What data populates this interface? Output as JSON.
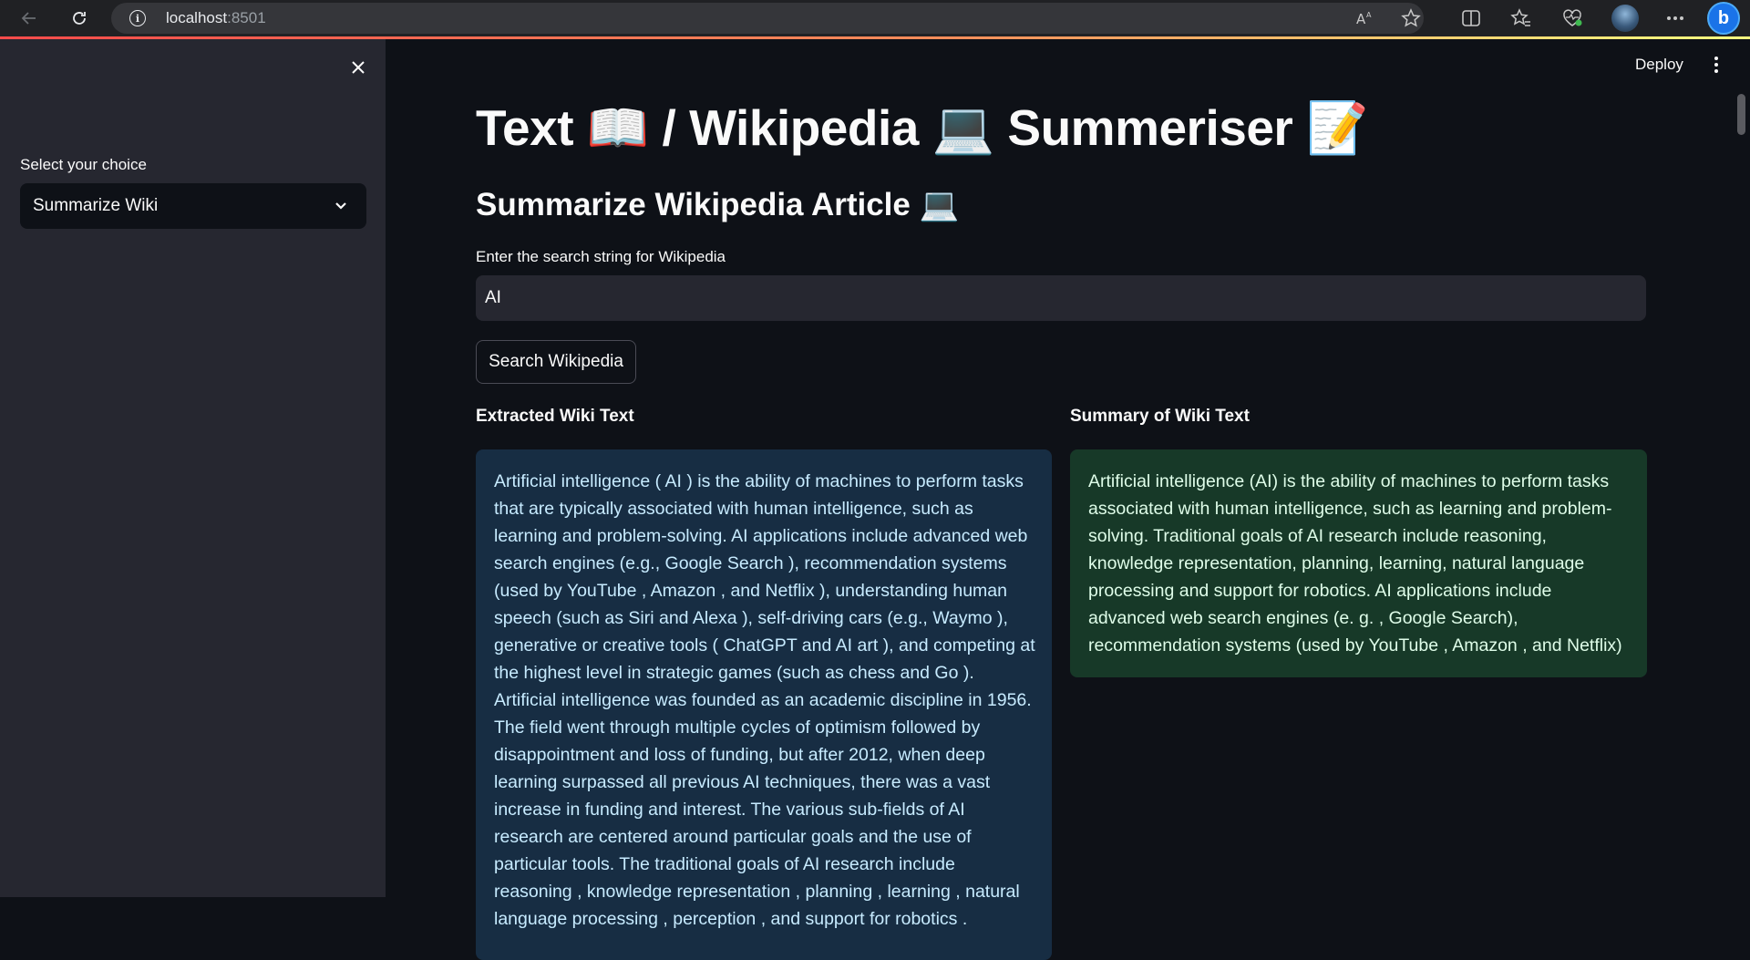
{
  "browser": {
    "url_host": "localhost",
    "url_port": ":8501"
  },
  "icons": {
    "back": "back-arrow-icon",
    "reload": "reload-icon",
    "info": "info-icon",
    "read_aloud": "read-aloud-icon",
    "favorite": "star-icon",
    "split_screen": "split-screen-icon",
    "favorites": "favorites-icon",
    "health": "heart-pulse-icon",
    "more": "more-icon",
    "bing": "bing-copilot-icon",
    "close": "close-icon",
    "chevron": "chevron-down-icon",
    "kebab": "kebab-menu-icon"
  },
  "sidebar": {
    "select_label": "Select your choice",
    "select_value": "Summarize Wiki"
  },
  "header": {
    "deploy_label": "Deploy"
  },
  "main": {
    "title": "Text 📖 / Wikipedia 💻 Summeriser 📝",
    "subtitle": "Summarize Wikipedia Article 💻",
    "input_label": "Enter the search string for Wikipedia",
    "input_value": "AI",
    "search_button": "Search Wikipedia",
    "extracted_header": "Extracted Wiki Text",
    "summary_header": "Summary of Wiki Text",
    "extracted_text": "Artificial intelligence ( AI ) is the ability of machines to perform tasks that are typically associated with human intelligence, such as learning and problem-solving. AI applications include advanced web search engines (e.g., Google Search ), recommendation systems (used by YouTube , Amazon , and Netflix ), understanding human speech (such as Siri and Alexa ), self-driving cars (e.g., Waymo ), generative or creative tools ( ChatGPT and AI art ), and competing at the highest level in strategic games (such as chess and Go ). Artificial intelligence was founded as an academic discipline in 1956. The field went through multiple cycles of optimism followed by disappointment and loss of funding, but after 2012, when deep learning surpassed all previous AI techniques, there was a vast increase in funding and interest. The various sub-fields of AI research are centered around particular goals and the use of particular tools. The traditional goals of AI research include reasoning , knowledge representation , planning , learning , natural language processing , perception , and support for robotics .",
    "summary_text": "Artificial intelligence (AI) is the ability of machines to perform tasks associated with human intelligence, such as learning and problem-solving. Traditional goals of AI research include reasoning, knowledge representation, planning, learning, natural language processing and support for robotics. AI applications include advanced web search engines (e. g. , Google Search), recommendation systems (used by YouTube , Amazon , and Netflix)"
  },
  "colors": {
    "background": "#0e1117",
    "sidebar": "#262730",
    "info_box": "#172d43",
    "info_text": "#c7ebff",
    "success_box": "#173928",
    "success_text": "#dffde9",
    "accent": "#ff4b4b"
  }
}
